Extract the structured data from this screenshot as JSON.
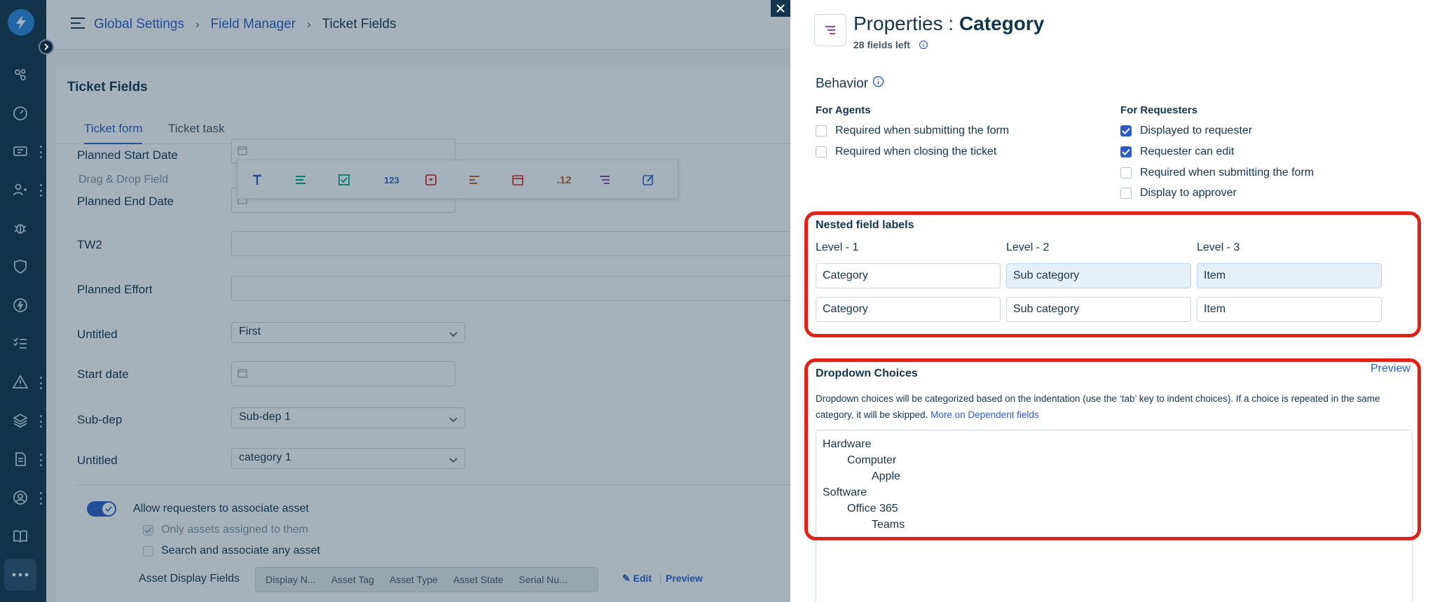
{
  "breadcrumb": {
    "items": [
      "Global Settings",
      "Field Manager"
    ],
    "current": "Ticket Fields"
  },
  "card": {
    "title": "Ticket Fields"
  },
  "tabs": [
    {
      "label": "Ticket form",
      "active": true
    },
    {
      "label": "Ticket task",
      "active": false
    }
  ],
  "form": {
    "fields": [
      {
        "label": "Planned Start Date",
        "type": "date",
        "value": ""
      },
      {
        "label": "Planned End Date",
        "type": "date",
        "value": ""
      },
      {
        "label": "TW2",
        "type": "text",
        "value": ""
      },
      {
        "label": "Planned Effort",
        "type": "text",
        "value": ""
      },
      {
        "label": "Untitled",
        "type": "dropdown",
        "value": "First"
      },
      {
        "label": "Start date",
        "type": "date",
        "value": ""
      },
      {
        "label": "Sub-dep",
        "type": "dropdown",
        "value": "Sub-dep 1"
      },
      {
        "label": "Untitled",
        "type": "dropdown",
        "value": "category 1"
      }
    ],
    "drag_drop_label": "Drag & Drop Field",
    "field_types": [
      "text-icon",
      "paragraph-icon",
      "checkbox-icon",
      "number-icon",
      "dropdown-icon",
      "multiline-icon",
      "date-icon",
      "decimal-icon",
      "nested-list-icon",
      "edit-icon"
    ],
    "field_type_glyphs": {
      "number": "123",
      "decimal": ".12"
    },
    "asset": {
      "toggle_label": "Allow requesters to associate asset",
      "toggle_on": true,
      "option_assigned": "Only assets assigned to them",
      "option_any": "Search and associate any asset",
      "display_fields_label": "Asset Display Fields",
      "display_fields": [
        "Display N...",
        "Asset Tag",
        "Asset Type",
        "Asset State",
        "Serial Nu..."
      ],
      "edit_label": "Edit",
      "preview_label": "Preview"
    }
  },
  "panel": {
    "title_prefix": "Properties : ",
    "title_field": "Category",
    "fields_left": "28 fields left",
    "behavior": {
      "title": "Behavior",
      "agents": {
        "heading": "For Agents",
        "options": [
          {
            "label": "Required when submitting the form",
            "checked": false
          },
          {
            "label": "Required when closing the ticket",
            "checked": false
          }
        ]
      },
      "requesters": {
        "heading": "For Requesters",
        "options": [
          {
            "label": "Displayed to requester",
            "checked": true
          },
          {
            "label": "Requester can edit",
            "checked": true
          },
          {
            "label": "Required when submitting the form",
            "checked": false
          },
          {
            "label": "Display to approver",
            "checked": false
          }
        ]
      }
    },
    "nested": {
      "title": "Nested field labels",
      "levels": [
        "Level - 1",
        "Level - 2",
        "Level - 3"
      ],
      "agent_labels": [
        "Category",
        "Sub category",
        "Item"
      ],
      "requester_labels": [
        "Category",
        "Sub category",
        "Item"
      ]
    },
    "dropdown": {
      "title": "Dropdown Choices",
      "preview_label": "Preview",
      "description": "Dropdown choices will be categorized based on the indentation (use the ‘tab’ key to indent choices). If a choice is repeated in the same category, it will be skipped.",
      "more_link": "More on Dependent fields",
      "choices": [
        {
          "text": "Hardware",
          "level": 0
        },
        {
          "text": "Computer",
          "level": 1
        },
        {
          "text": "Apple",
          "level": 2
        },
        {
          "text": "Software",
          "level": 0
        },
        {
          "text": "Office 365",
          "level": 1
        },
        {
          "text": "Teams",
          "level": 2
        }
      ]
    }
  },
  "colors": {
    "accent": "#2c5cc5",
    "highlight": "#e0231a",
    "rail": "#13314a",
    "text": "#12344d"
  }
}
